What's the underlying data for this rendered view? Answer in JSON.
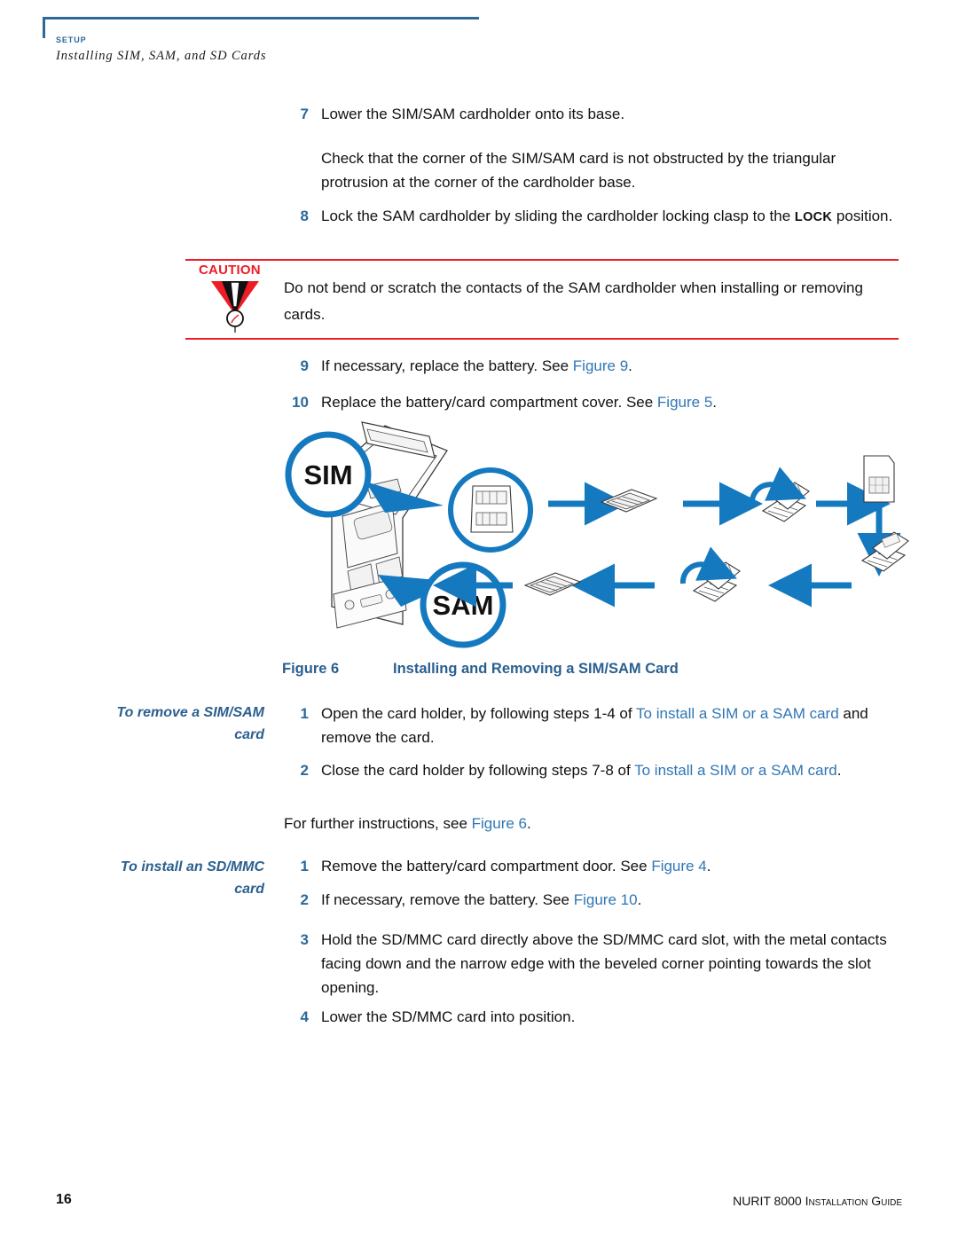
{
  "header": {
    "chapter": "Setup",
    "section": "Installing SIM, SAM, and SD Cards",
    "rule_color": "#2b6a9b"
  },
  "steps_top": [
    {
      "num": "7",
      "text": "Lower the SIM/SAM cardholder onto its base."
    }
  ],
  "paragraph_after_step7": "Check that the corner of the SIM/SAM card is not obstructed by the triangular protrusion at the corner of the cardholder base.",
  "step8": {
    "num": "8",
    "text_before": "Lock the SAM cardholder by sliding the cardholder locking clasp to the ",
    "emphasis": "LOCK",
    "text_after": " position."
  },
  "caution": {
    "label": "CAUTION",
    "icon": "warning-triangle-icon",
    "text": "Do not bend or scratch the contacts of the SAM cardholder when installing or removing cards.",
    "rule_color": "#ee1c25"
  },
  "steps_after_caution": [
    {
      "num": "9",
      "text_before": "If necessary, replace the battery. See ",
      "xref": "Figure 9",
      "text_after": "."
    },
    {
      "num": "10",
      "text_before": "Replace the battery/card compartment cover. See ",
      "xref": "Figure 5",
      "text_after": "."
    }
  ],
  "figure": {
    "label": "Figure 6",
    "title": "Installing and Removing a SIM/SAM Card",
    "callout_sim": "SIM",
    "callout_sam": "SAM",
    "callout_color": "#1579c0"
  },
  "section_remove": {
    "heading_line1": "To remove a SIM/SAM",
    "heading_line2": "card",
    "steps": [
      {
        "num": "1",
        "text_before": "Open the card holder, by following steps 1-4 of ",
        "xref": "To install a SIM or a SAM card",
        "text_after": " and remove the card."
      },
      {
        "num": "2",
        "text_before": "Close the card holder by following steps 7-8 of ",
        "xref": "To install a SIM or a SAM card",
        "text_after": "."
      }
    ],
    "closing_before": "For further instructions, see ",
    "closing_xref": "Figure 6",
    "closing_after": "."
  },
  "section_sd": {
    "heading_line1": "To install an SD/MMC",
    "heading_line2": "card",
    "steps": [
      {
        "num": "1",
        "text_before": "Remove the battery/card compartment door. See ",
        "xref": "Figure 4",
        "text_after": "."
      },
      {
        "num": "2",
        "text_before": "If necessary, remove the battery. See ",
        "xref": "Figure 10",
        "text_after": "."
      },
      {
        "num": "3",
        "text_before": "Hold the SD/MMC card directly above the SD/MMC card slot, with the metal contacts facing down and the narrow edge with the beveled corner pointing towards the slot opening.",
        "xref": "",
        "text_after": ""
      },
      {
        "num": "4",
        "text_before": "Lower the SD/MMC card into position.",
        "xref": "",
        "text_after": ""
      }
    ]
  },
  "footer": {
    "page_number": "16",
    "guide_title": "NURIT 8000 Installation Guide"
  }
}
